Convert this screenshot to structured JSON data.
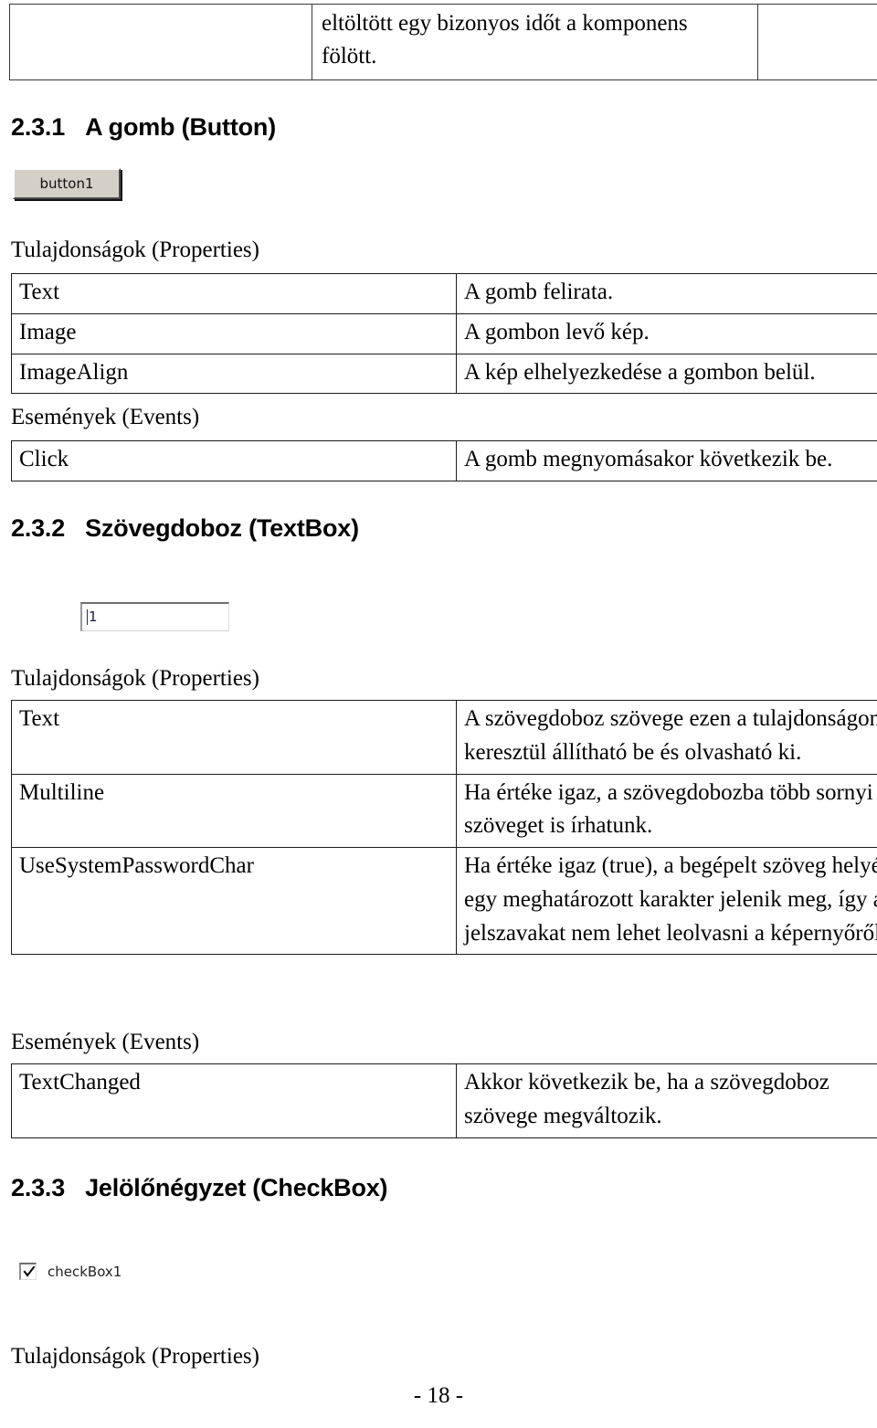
{
  "document": {
    "language": "hu",
    "page_number_label": "- 18 -"
  },
  "continued_table": {
    "left_cell": "",
    "middle_cell": "eltöltött egy bizonyos időt a komponens fölött.",
    "right_cell": ""
  },
  "sections": [
    {
      "number": "2.3.1",
      "title": "A gomb (Button)",
      "widget": {
        "type": "button",
        "label": "button1"
      },
      "properties_label": "Tulajdonságok (Properties)",
      "properties": [
        {
          "name": "Text",
          "description": "A gomb felirata."
        },
        {
          "name": "Image",
          "description": "A gombon levő kép."
        },
        {
          "name": "ImageAlign",
          "description": "A kép elhelyezkedése a gombon belül."
        }
      ],
      "events_label": "Események (Events)",
      "events": [
        {
          "name": "Click",
          "description": "A gomb megnyomásakor következik be."
        }
      ]
    },
    {
      "number": "2.3.2",
      "title": "Szövegdoboz (TextBox)",
      "widget": {
        "type": "textbox",
        "value": "1"
      },
      "properties_label": "Tulajdonságok (Properties)",
      "properties": [
        {
          "name": "Text",
          "description": "A szövegdoboz szövege ezen a tulajdonságon keresztül állítható be és olvasható ki."
        },
        {
          "name": "Multiline",
          "description": "Ha értéke igaz, a szövegdobozba több sornyi szöveget is írhatunk."
        },
        {
          "name": "UseSystemPasswordChar",
          "description": "Ha értéke igaz (true), a begépelt szöveg helyén egy meghatározott karakter jelenik meg, így a jelszavakat nem lehet leolvasni a képernyőről."
        }
      ],
      "events_label": "Események (Events)",
      "events": [
        {
          "name": "TextChanged",
          "description": "Akkor következik be, ha a szövegdoboz szövege megváltozik."
        }
      ]
    },
    {
      "number": "2.3.3",
      "title": "Jelölőnégyzet (CheckBox)",
      "widget": {
        "type": "checkbox",
        "label": "checkBox1",
        "checked": true
      },
      "properties_label": "Tulajdonságok (Properties)"
    }
  ]
}
